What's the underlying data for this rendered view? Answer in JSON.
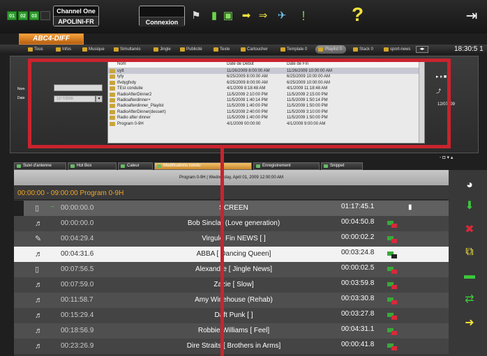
{
  "topbar": {
    "channel": {
      "name": "Channel One",
      "server": "APOLINI-FR"
    },
    "connect_label": "Connexion",
    "chips": [
      "01",
      "02",
      "03"
    ],
    "help_symbol": "?"
  },
  "page_tab": "ABC4-DIFF",
  "filters": [
    {
      "label": "Tous",
      "active": false
    },
    {
      "label": "Infos",
      "active": false
    },
    {
      "label": "Musique",
      "active": false
    },
    {
      "label": "Simultanés",
      "active": false
    },
    {
      "label": "Jingle",
      "active": false
    },
    {
      "label": "Publicité",
      "active": false
    },
    {
      "label": "Texte",
      "active": false
    },
    {
      "label": "Cartoucher",
      "active": false
    },
    {
      "label": "Template 0",
      "active": false
    },
    {
      "label": "Playlist 0",
      "active": true
    },
    {
      "label": "Stack 0",
      "active": false
    },
    {
      "label": "sport-news",
      "active": false
    }
  ],
  "clock": "18:30:5 1",
  "upper": {
    "date_label": "Date",
    "name_label": "Nom",
    "date_value": "12/ 7/2009",
    "right_value": "12/07/ 09",
    "columns": [
      "Nom",
      "Date de Début",
      "Date de Fin"
    ],
    "rows": [
      {
        "name": "uytt",
        "start": "11/26/2009 8:00:00 AM",
        "end": "11/26/2009 10:00:00 AM",
        "selected": true
      },
      {
        "name": "tyty",
        "start": "6/25/2009 8:00:00 AM",
        "end": "6/25/2009 10:00:00 AM",
        "selected": false
      },
      {
        "name": "tfvdygfxdy",
        "start": "6/25/2009 8:00:00 AM",
        "end": "6/25/2009 10:00:00 AM",
        "selected": false
      },
      {
        "name": "TEst conduite",
        "start": "4/1/2009 8:18:48 AM",
        "end": "4/1/2009 11:18:48 AM",
        "selected": false
      },
      {
        "name": "RadioAfterDinner2",
        "start": "11/5/2009 2:10:00 PM",
        "end": "11/5/2009 2:15:00 PM",
        "selected": false
      },
      {
        "name": "Radioafterdinner+",
        "start": "11/5/2009 1:40:14 PM",
        "end": "11/5/2009 1:50:14 PM",
        "selected": false
      },
      {
        "name": "Radioafterdinner_Playlist",
        "start": "11/5/2009 1:40:00 PM",
        "end": "11/5/2009 1:50:00 PM",
        "selected": false
      },
      {
        "name": "RadioAfterDinner(dessert)",
        "start": "11/5/2009 2:40:00 PM",
        "end": "11/5/2009 3:10:00 PM",
        "selected": false
      },
      {
        "name": "Radio after dinner",
        "start": "11/5/2009 1:40:00 PM",
        "end": "11/5/2009 1:50:00 PM",
        "selected": false
      },
      {
        "name": "Program 0-9H",
        "start": "4/1/2009 00:00:00",
        "end": "4/1/2009 9:00:00 AM",
        "selected": false
      }
    ]
  },
  "tabs": [
    {
      "label": "Suivi d'antenne",
      "active": false
    },
    {
      "label": "Hot Box",
      "active": false
    },
    {
      "label": "Caleur",
      "active": false
    },
    {
      "label": "Modifications condu",
      "active": true
    },
    {
      "label": "Enregistrement",
      "active": false
    },
    {
      "label": "Snippet",
      "active": false
    }
  ],
  "subheader": "Program 0-9H  |  Wednesday, April 01, 2009 12:00:00 AM",
  "program_bar": "00:00:00 - 09:00:00    Program 0-9H",
  "list": [
    {
      "time": "00:00:00.0",
      "title": "SCREEN",
      "duration": "01:17:45.1",
      "kind": "header"
    },
    {
      "time": "00:00:00.0",
      "title": "Bob Sinclar (Love generation)",
      "duration": "00:04:50.8",
      "kind": "music"
    },
    {
      "time": "00:04:29.4",
      "title": "Virgule Fin NEWS [ ]",
      "duration": "00:00:02.2",
      "kind": "news"
    },
    {
      "time": "00:04:31.6",
      "title": "ABBA [ Dancing Queen]",
      "duration": "00:03:24.8",
      "kind": "music",
      "selected": true
    },
    {
      "time": "00:07:56.5",
      "title": "Alexandre [ Jingle News]",
      "duration": "00:00:02.5",
      "kind": "doc"
    },
    {
      "time": "00:07:59.0",
      "title": "Zazie [ Slow]",
      "duration": "00:03:59.8",
      "kind": "music"
    },
    {
      "time": "00:11:58.7",
      "title": "Amy Winehouse (Rehab)",
      "duration": "00:03:30.8",
      "kind": "music"
    },
    {
      "time": "00:15:29.4",
      "title": "Daft Punk [ ]",
      "duration": "00:03:27.8",
      "kind": "music"
    },
    {
      "time": "00:18:56.9",
      "title": "Robbie Williams [ Feel]",
      "duration": "00:04:31.1",
      "kind": "music"
    },
    {
      "time": "00:23:26.9",
      "title": "Dire Straits [ Brothers in Arms]",
      "duration": "00:00:41.8",
      "kind": "music"
    }
  ]
}
